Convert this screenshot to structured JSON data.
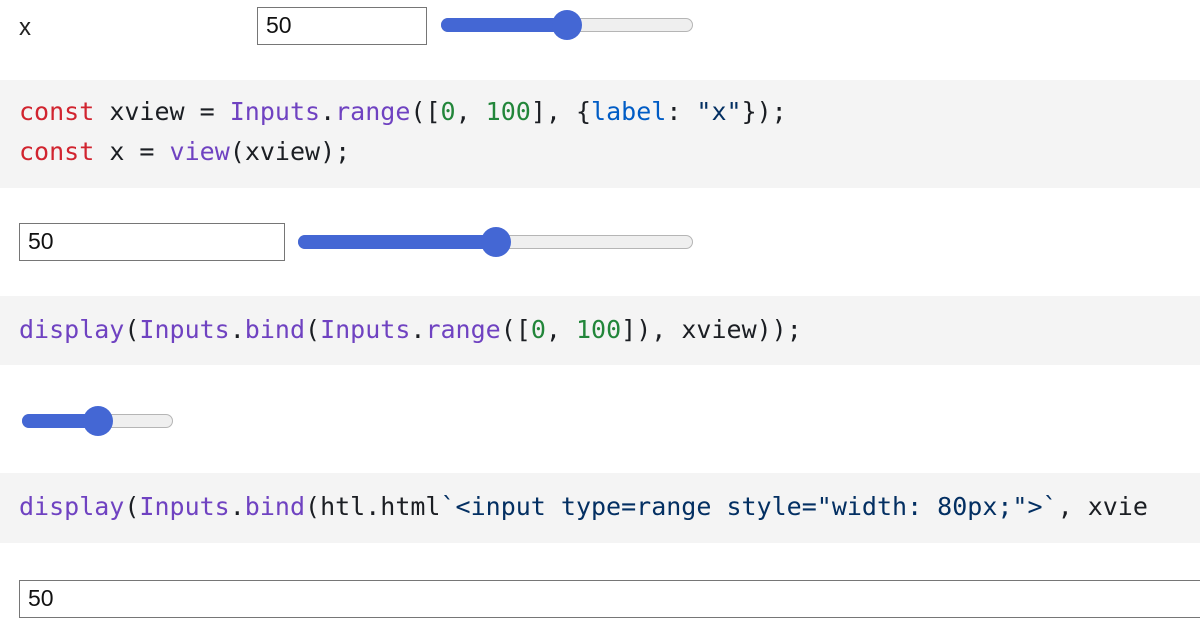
{
  "form1": {
    "label": "x",
    "input_value": "50",
    "slider_value": 50,
    "slider_min": 0,
    "slider_max": 100
  },
  "code1": {
    "line1": [
      {
        "t": "const",
        "c": "kw"
      },
      {
        "t": " xview ",
        "c": "plain"
      },
      {
        "t": "=",
        "c": "plain"
      },
      {
        "t": " ",
        "c": "plain"
      },
      {
        "t": "Inputs",
        "c": "fn"
      },
      {
        "t": ".",
        "c": "plain"
      },
      {
        "t": "range",
        "c": "fn"
      },
      {
        "t": "([",
        "c": "plain"
      },
      {
        "t": "0",
        "c": "num"
      },
      {
        "t": ", ",
        "c": "plain"
      },
      {
        "t": "100",
        "c": "num"
      },
      {
        "t": "], {",
        "c": "plain"
      },
      {
        "t": "label",
        "c": "prop"
      },
      {
        "t": ": ",
        "c": "plain"
      },
      {
        "t": "\"x\"",
        "c": "str"
      },
      {
        "t": "});",
        "c": "plain"
      }
    ],
    "line2": [
      {
        "t": "const",
        "c": "kw"
      },
      {
        "t": " x ",
        "c": "plain"
      },
      {
        "t": "=",
        "c": "plain"
      },
      {
        "t": " ",
        "c": "plain"
      },
      {
        "t": "view",
        "c": "fn"
      },
      {
        "t": "(xview);",
        "c": "plain"
      }
    ]
  },
  "form2": {
    "input_value": "50",
    "slider_value": 50,
    "slider_min": 0,
    "slider_max": 100
  },
  "code2": {
    "line1": [
      {
        "t": "display",
        "c": "fn"
      },
      {
        "t": "(",
        "c": "plain"
      },
      {
        "t": "Inputs",
        "c": "fn"
      },
      {
        "t": ".",
        "c": "plain"
      },
      {
        "t": "bind",
        "c": "fn"
      },
      {
        "t": "(",
        "c": "plain"
      },
      {
        "t": "Inputs",
        "c": "fn"
      },
      {
        "t": ".",
        "c": "plain"
      },
      {
        "t": "range",
        "c": "fn"
      },
      {
        "t": "([",
        "c": "plain"
      },
      {
        "t": "0",
        "c": "num"
      },
      {
        "t": ", ",
        "c": "plain"
      },
      {
        "t": "100",
        "c": "num"
      },
      {
        "t": "]), xview));",
        "c": "plain"
      }
    ]
  },
  "form3": {
    "slider_value": 50,
    "slider_min": 0,
    "slider_max": 100
  },
  "code3": {
    "line1": [
      {
        "t": "display",
        "c": "fn"
      },
      {
        "t": "(",
        "c": "plain"
      },
      {
        "t": "Inputs",
        "c": "fn"
      },
      {
        "t": ".",
        "c": "plain"
      },
      {
        "t": "bind",
        "c": "fn"
      },
      {
        "t": "(htl.html",
        "c": "plain"
      },
      {
        "t": "`<input type=range style=\"width: 80px;\">`",
        "c": "str"
      },
      {
        "t": ", xvie",
        "c": "plain"
      }
    ]
  },
  "form4": {
    "input_value": "50"
  },
  "colors": {
    "accent": "#4467d4",
    "code_background": "#f4f4f4",
    "keyword": "#d1242f",
    "function": "#6f42c1",
    "number": "#22863a",
    "property": "#005cc5",
    "string": "#032f62"
  }
}
